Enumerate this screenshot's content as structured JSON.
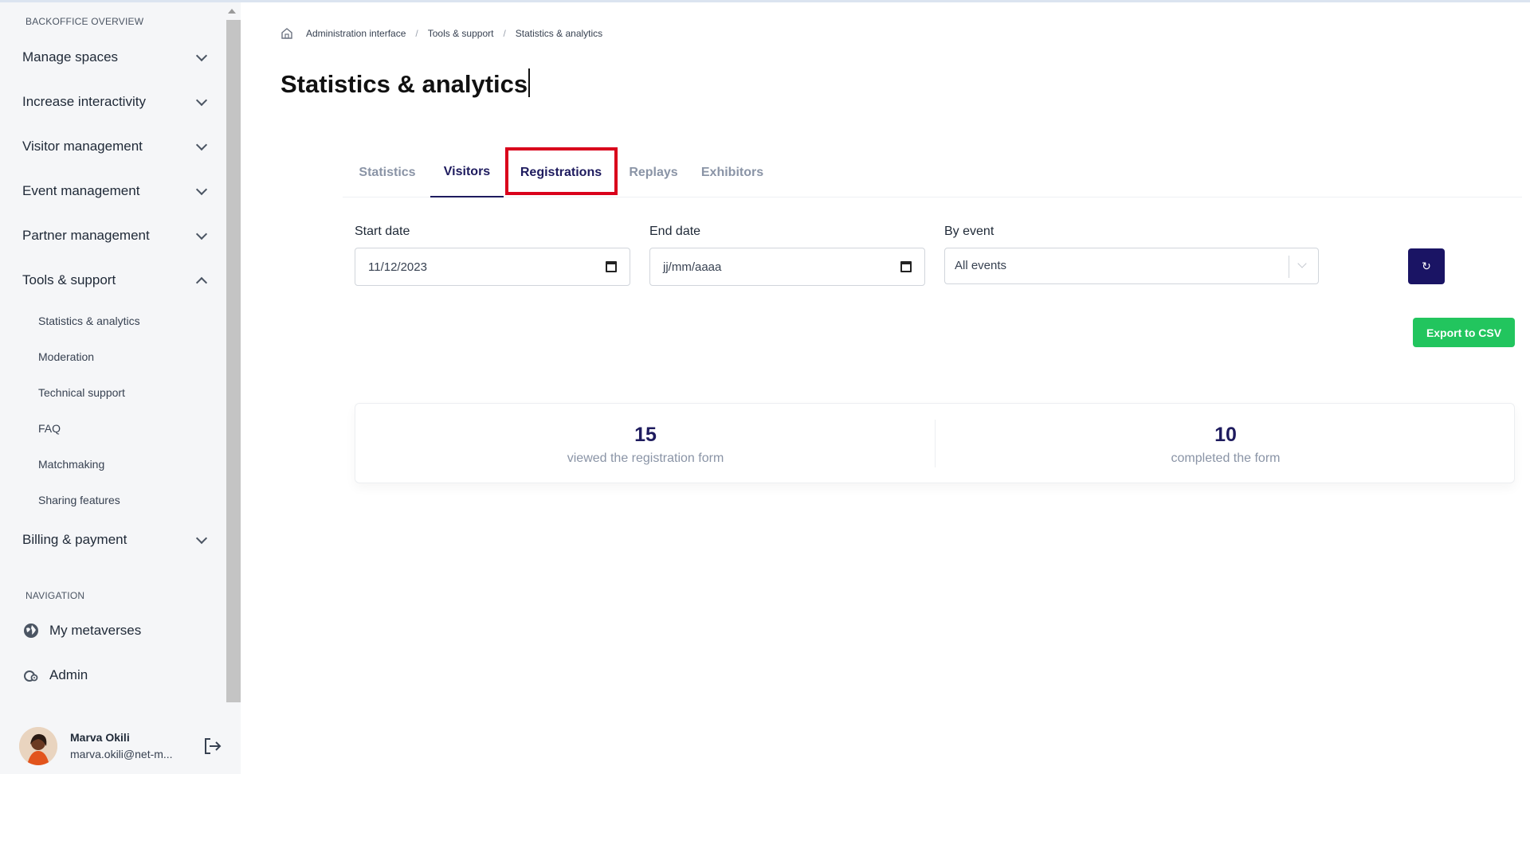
{
  "sidebar": {
    "section_backoffice": "BACKOFFICE OVERVIEW",
    "items": [
      {
        "label": "Manage spaces"
      },
      {
        "label": "Increase interactivity"
      },
      {
        "label": "Visitor management"
      },
      {
        "label": "Event management"
      },
      {
        "label": "Partner management"
      },
      {
        "label": "Tools & support"
      },
      {
        "label": "Billing & payment"
      }
    ],
    "tools_subitems": [
      {
        "label": "Statistics & analytics"
      },
      {
        "label": "Moderation"
      },
      {
        "label": "Technical support"
      },
      {
        "label": "FAQ"
      },
      {
        "label": "Matchmaking"
      },
      {
        "label": "Sharing features"
      }
    ],
    "section_navigation": "NAVIGATION",
    "nav_items": [
      {
        "label": "My metaverses",
        "icon": "globe-icon"
      },
      {
        "label": "Admin",
        "icon": "admin-icon"
      }
    ],
    "user": {
      "name": "Marva Okili",
      "email": "marva.okili@net-m..."
    }
  },
  "breadcrumb": {
    "items": [
      "Administration interface",
      "Tools & support",
      "Statistics & analytics"
    ]
  },
  "page": {
    "title": "Statistics & analytics"
  },
  "tabs": [
    {
      "label": "Statistics"
    },
    {
      "label": "Visitors"
    },
    {
      "label": "Registrations"
    },
    {
      "label": "Replays"
    },
    {
      "label": "Exhibitors"
    }
  ],
  "filters": {
    "start_date_label": "Start date",
    "start_date_value": "11/12/2023",
    "end_date_label": "End date",
    "end_date_placeholder": "jj/mm/aaaa",
    "event_label": "By event",
    "event_value": "All events"
  },
  "actions": {
    "refresh_glyph": "↻",
    "export_label": "Export to CSV"
  },
  "stats": [
    {
      "value": "15",
      "label": "viewed the registration form"
    },
    {
      "value": "10",
      "label": "completed the form"
    }
  ],
  "colors": {
    "primary": "#1e1b5e",
    "export_green": "#22c55e",
    "highlight_red": "#d9001b"
  }
}
